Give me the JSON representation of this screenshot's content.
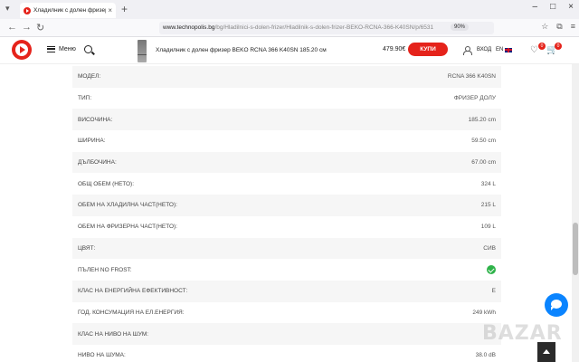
{
  "browser": {
    "tab_title": "Хладилник с долен фризер BEKO",
    "tab_close": "×",
    "new_tab": "+",
    "url_host": "www.technopolis.bg",
    "url_path": "/bg/Hladilnici-s-dolen-frizer/Hladilnik-s-dolen-frizer-BEKO-RCNA-366-K40SN/p/6531",
    "zoom": "90%",
    "window_controls": [
      "–",
      "□",
      "×"
    ],
    "toolbar_left": [
      "←",
      "→",
      "↻"
    ]
  },
  "header": {
    "menu_label": "Меню",
    "product_name": "Хладилник с долен фризер BEKO RCNA 366 K40SN 185.20 см",
    "price": "479.90€",
    "buy_label": "КУПИ",
    "login_label": "ВХОД",
    "lang_label": "EN",
    "wishlist_count": "0",
    "cart_count": "0"
  },
  "specs": [
    {
      "label": "МОДЕЛ:",
      "value": "RCNA 366 K40SN"
    },
    {
      "label": "ТИП:",
      "value": "ФРИЗЕР ДОЛУ"
    },
    {
      "label": "ВИСОЧИНА:",
      "value": "185.20 cm"
    },
    {
      "label": "ШИРИНА:",
      "value": "59.50 cm"
    },
    {
      "label": "ДЪЛБОЧИНА:",
      "value": "67.00 cm"
    },
    {
      "label": "ОБЩ ОБЕМ (НЕТО):",
      "value": "324 L"
    },
    {
      "label": "ОБЕМ НА ХЛАДИЛНА ЧАСТ(НЕТО):",
      "value": "215 L"
    },
    {
      "label": "ОБЕМ НА ФРИЗЕРНА ЧАСТ(НЕТО):",
      "value": "109 L"
    },
    {
      "label": "ЦВЯТ:",
      "value": "СИВ"
    },
    {
      "label": "ПЪЛЕН NO FROST:",
      "value": ""
    },
    {
      "label": "КЛАС НА ЕНЕРГИЙНА ЕФЕКТИВНОСТ:",
      "value": "E"
    },
    {
      "label": "ГОД. КОНСУМАЦИЯ НА ЕЛ.ЕНЕРГИЯ:",
      "value": "249 kWh"
    },
    {
      "label": "КЛАС НА НИВО НА ШУМ:",
      "value": ""
    },
    {
      "label": "НИВО НА ШУМА:",
      "value": "38.0 dB"
    }
  ],
  "watermark": "BAZAR",
  "colors": {
    "brand": "#e5231b",
    "check": "#2fb34a",
    "chat": "#0a84ff"
  }
}
